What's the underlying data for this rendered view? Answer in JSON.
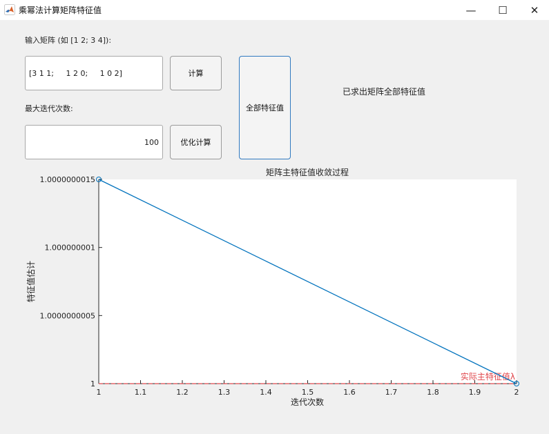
{
  "window": {
    "title": "乘幂法计算矩阵特征值",
    "minimize_symbol": "—",
    "maximize_symbol": "☐",
    "close_symbol": "✕"
  },
  "form": {
    "matrix_label": "输入矩阵 (如 [1 2; 3 4]):",
    "matrix_value": "[3 1 1;     1 2 0;     1 0 2]",
    "compute_label": "计算",
    "max_iter_label": "最大迭代次数:",
    "max_iter_value": "100",
    "optimize_label": "优化计算",
    "all_eigen_label": "全部特征值",
    "status_text": "已求出矩阵全部特征值"
  },
  "chart_data": {
    "type": "line",
    "title": "矩阵主特征值收敛过程",
    "xlabel": "迭代次数",
    "ylabel": "特征值估计",
    "xlim": [
      1,
      2
    ],
    "ylim": [
      1,
      1.0000000015
    ],
    "xticks": [
      1,
      1.1,
      1.2,
      1.3,
      1.4,
      1.5,
      1.6,
      1.7,
      1.8,
      1.9,
      2
    ],
    "xtick_labels": [
      "1",
      "1.1",
      "1.2",
      "1.3",
      "1.4",
      "1.5",
      "1.6",
      "1.7",
      "1.8",
      "1.9",
      "2"
    ],
    "yticks": [
      1,
      1.0000000005,
      1.000000001,
      1.0000000015
    ],
    "ytick_labels": [
      "1",
      "1.0000000005",
      "1.000000001",
      "1.0000000015"
    ],
    "series": [
      {
        "x": [
          1,
          2
        ],
        "y": [
          1.0000000015,
          1
        ],
        "color": "#0072bd",
        "marker": "circle"
      }
    ],
    "reference_line": {
      "y": 1,
      "label": "实际主特征值λ",
      "color": "#e0474c"
    }
  }
}
